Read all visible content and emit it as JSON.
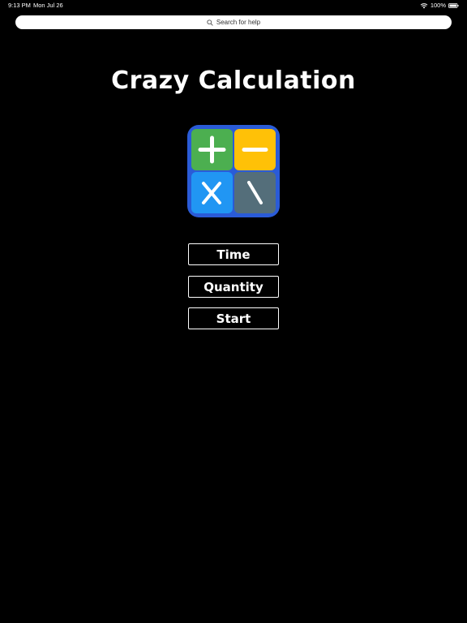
{
  "status_bar": {
    "time": "9:13 PM",
    "date": "Mon Jul 26",
    "battery": "100%"
  },
  "search": {
    "placeholder": "Search for help"
  },
  "app": {
    "title": "Crazy Calculation"
  },
  "logo": {
    "tiles": [
      {
        "symbol": "plus",
        "color": "#4caf50"
      },
      {
        "symbol": "minus",
        "color": "#ffc107"
      },
      {
        "symbol": "multiply",
        "color": "#2196f3"
      },
      {
        "symbol": "divide",
        "color": "#546e7a"
      }
    ],
    "frame_color": "#2a5bd7"
  },
  "menu": {
    "time_label": "Time",
    "quantity_label": "Quantity",
    "start_label": "Start"
  }
}
